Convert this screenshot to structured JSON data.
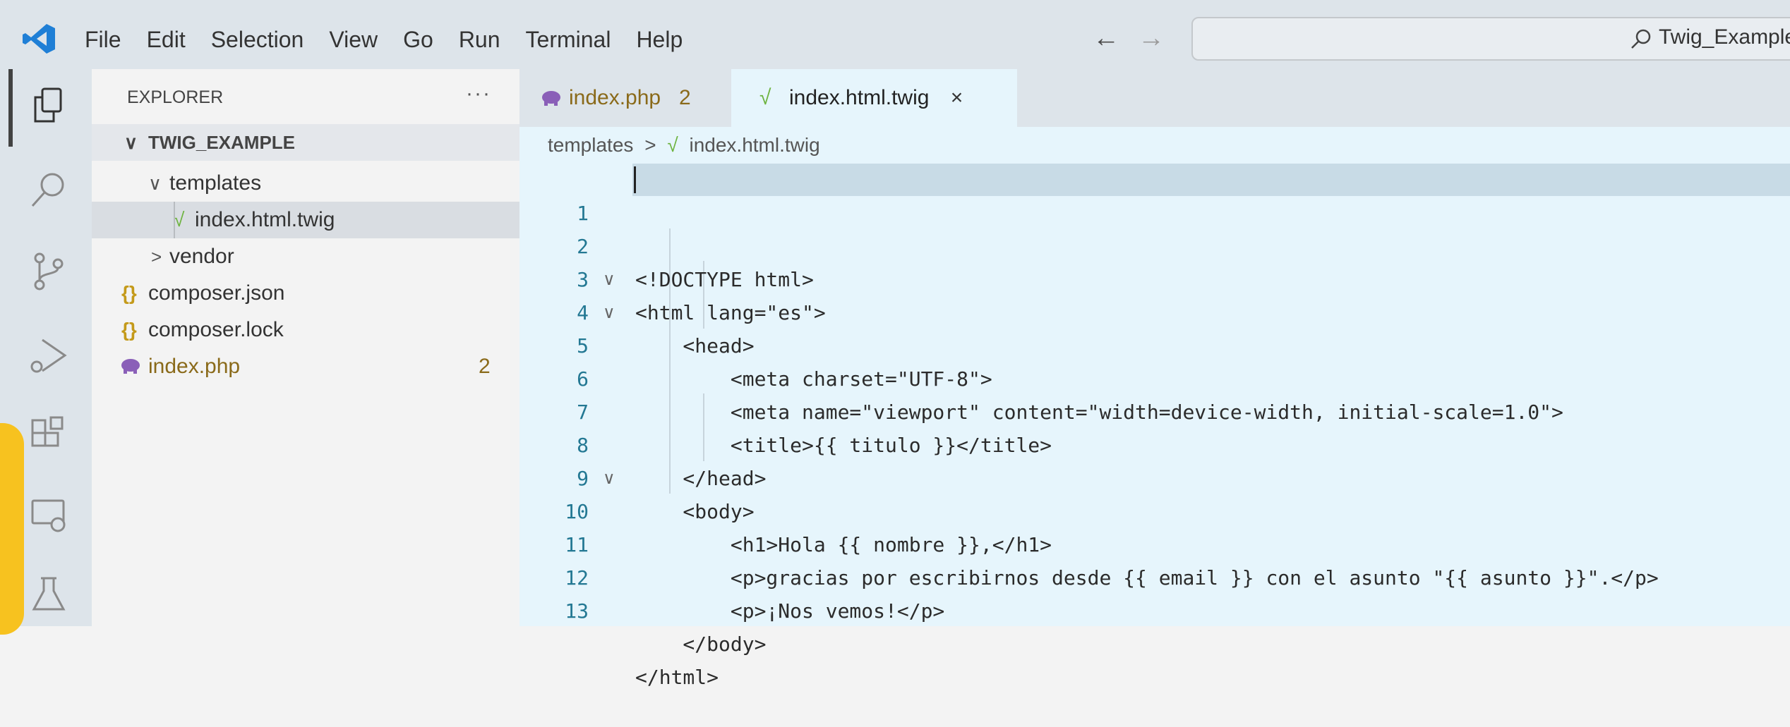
{
  "menu": [
    "File",
    "Edit",
    "Selection",
    "View",
    "Go",
    "Run",
    "Terminal",
    "Help"
  ],
  "nav": {
    "back": "←",
    "forward": "→"
  },
  "search": {
    "text": "Twig_Example"
  },
  "sidebar": {
    "header": "EXPLORER",
    "more": "···",
    "project": "TWIG_EXAMPLE",
    "items": [
      {
        "label": "templates",
        "chevron": "∨"
      },
      {
        "label": "index.html.twig",
        "icon": "√"
      },
      {
        "label": "vendor",
        "chevron": ">"
      },
      {
        "label": "composer.json",
        "icon": "{}"
      },
      {
        "label": "composer.lock",
        "icon": "{}"
      },
      {
        "label": "index.php",
        "badge": "2"
      }
    ]
  },
  "tabs": [
    {
      "label": "index.php",
      "badge": "2"
    },
    {
      "label": "index.html.twig",
      "close": "×",
      "icon": "√"
    }
  ],
  "breadcrumb": {
    "folder": "templates",
    "sep": ">",
    "file": "index.html.twig"
  },
  "code": [
    {
      "n": "1",
      "fold": "",
      "text": "<!DOCTYPE html>"
    },
    {
      "n": "2",
      "fold": "∨",
      "text": "<html lang=\"es\">"
    },
    {
      "n": "3",
      "fold": "∨",
      "text": "    <head>"
    },
    {
      "n": "4",
      "fold": "",
      "text": "        <meta charset=\"UTF-8\">"
    },
    {
      "n": "5",
      "fold": "",
      "text": "        <meta name=\"viewport\" content=\"width=device-width, initial-scale=1.0\">"
    },
    {
      "n": "6",
      "fold": "",
      "text": "        <title>{{ titulo }}</title>"
    },
    {
      "n": "7",
      "fold": "",
      "text": "    </head>"
    },
    {
      "n": "8",
      "fold": "∨",
      "text": "    <body>"
    },
    {
      "n": "9",
      "fold": "",
      "text": "        <h1>Hola {{ nombre }},</h1>"
    },
    {
      "n": "10",
      "fold": "",
      "text": "        <p>gracias por escribirnos desde {{ email }} con el asunto \"{{ asunto }}\".</p>"
    },
    {
      "n": "11",
      "fold": "",
      "text": "        <p>¡Nos vemos!</p>"
    },
    {
      "n": "12",
      "fold": "",
      "text": "    </body>"
    },
    {
      "n": "13",
      "fold": "",
      "text": "</html>"
    }
  ],
  "colors": {
    "accent_blue": "#0d8fe0",
    "accent_yellow": "#f7c21f",
    "editor_bg": "#e6f5fc"
  }
}
